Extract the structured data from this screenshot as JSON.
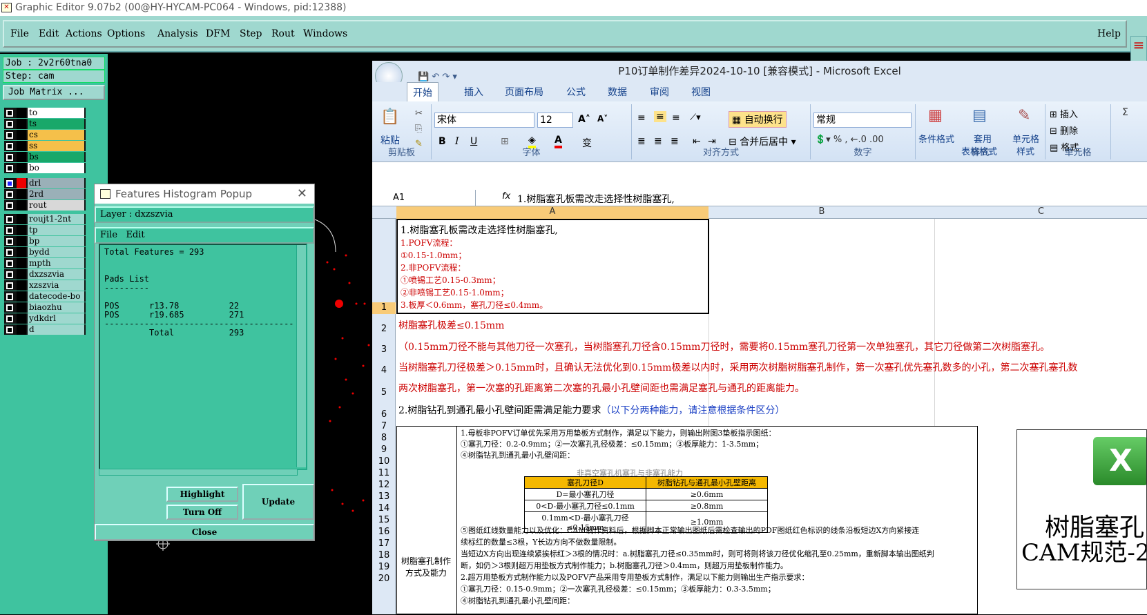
{
  "window": {
    "title": "Graphic Editor 9.07b2 (00@HY-HYCAM-PC064 - Windows, pid:12388)"
  },
  "menu": [
    "File",
    "Edit",
    "Actions",
    "Options",
    "Analysis",
    "DFM",
    "Step",
    "Rout",
    "Windows"
  ],
  "help": "Help",
  "job": {
    "job": "Job : 2v2r60tna0",
    "step": "Step: cam",
    "matrix": "Job Matrix ..."
  },
  "layers1": [
    {
      "name": "to",
      "color": "#ffffff"
    },
    {
      "name": "ts",
      "color": "#19a86a"
    },
    {
      "name": "cs",
      "color": "#f5c04a"
    },
    {
      "name": "ss",
      "color": "#f5c04a"
    },
    {
      "name": "bs",
      "color": "#19a86a"
    },
    {
      "name": "bo",
      "color": "#ffffff"
    }
  ],
  "layers2": [
    {
      "name": "drl",
      "color": "#9ab0b8"
    },
    {
      "name": "2rd",
      "color": "#9ab0b8"
    },
    {
      "name": "rout",
      "color": "#d8d8d8"
    }
  ],
  "layers3": [
    "roujt1-2nt",
    "tp",
    "bp",
    "bydd",
    "mpth",
    "dxzszvia",
    "xzszvia",
    "datecode-bo",
    "biaozhu",
    "ydkdrl",
    "d"
  ],
  "hist": {
    "title": "Features Histogram Popup",
    "layer": "Layer :  dxzszvia",
    "file": "File",
    "edit": "Edit",
    "content": "Total Features = 293\n\n\nPads List\n---------\n\nPOS      r13.78          22\nPOS      r19.685         271\n--------------------------------------\n         Total           293",
    "highlight": "Highlight",
    "turnoff": "Turn Off",
    "update": "Update",
    "close": "Close"
  },
  "excel": {
    "title": "P10订单制作差异2024-10-10  [兼容模式] - Microsoft Excel",
    "tabs": [
      "开始",
      "插入",
      "页面布局",
      "公式",
      "数据",
      "审阅",
      "视图"
    ],
    "font": "宋体",
    "size": "12",
    "paste": "粘贴",
    "wrap": "自动换行",
    "merge": "合并后居中",
    "numfmt": "常规",
    "cond": "条件格式",
    "table1": "套用",
    "table2": "表格格式",
    "cellstyle1": "单元格",
    "cellstyle2": "样式",
    "insert": "插入",
    "delete": "删除",
    "format": "格式",
    "groups": [
      "剪贴板",
      "字体",
      "对齐方式",
      "数字",
      "样式",
      "单元格"
    ],
    "namebox": "A1",
    "formula": "1.树脂塞孔板需改走选择性树脂塞孔,",
    "cols": [
      "A",
      "B",
      "C"
    ],
    "rows": [
      "1",
      "2",
      "3",
      "4",
      "5",
      "6",
      "7",
      "8",
      "9",
      "10",
      "11",
      "12",
      "13",
      "14",
      "15",
      "16",
      "17",
      "18",
      "19",
      "20"
    ],
    "a1": [
      "1.树脂塞孔板需改走选择性树脂塞孔,",
      "1.POFV流程：",
      "①0.15-1.0mm；",
      "2.非POFV流程：",
      "①喷锡工艺0.15-0.3mm；",
      "②非喷锡工艺0.15-1.0mm；",
      "3.板厚＜0.6mm，塞孔刀径≤0.4mm。"
    ],
    "r2": "树脂塞孔极差≤0.15mm",
    "r3": "（0.15mm刀径不能与其他刀径一次塞孔，当树脂塞孔刀径含0.15mm刀径时，需要将0.15mm塞孔刀径第一次单独塞孔，其它刀径做第二次树脂塞孔。",
    "r4": "当树脂塞孔刀径极差＞0.15mm时，且确认无法优化到0.15mm极差以内时，采用两次树脂树脂塞孔制作，第一次塞孔优先塞孔数多的小孔，第二次塞孔塞孔数",
    "r5": "两次树脂塞孔，第一次塞的孔距离第二次塞的孔最小孔壁间距也需满足塞孔与通孔的距离能力。",
    "r6a": "2.树脂钻孔到通孔最小孔壁间距需满足能力要求",
    "r6b": "（以下分两种能力，请注意根据条件区分）",
    "label": [
      "树脂塞孔制作",
      "方式及能力"
    ],
    "doc": [
      "1.母板非POFV订单优先采用万用垫板方式制作，满足以下能力，则输出附图3垫板指示图纸：",
      "①塞孔刀径：0.2-0.9mm；②一次塞孔孔径极差：≤0.15mm；③板厚能力：1-3.5mm；",
      "④树脂钻孔到通孔最小孔壁间距："
    ],
    "tcap": "非真空塞孔机塞孔与非塞孔能力",
    "thead": [
      "塞孔刀径D",
      "树脂钻孔与通孔最小孔壁距离"
    ],
    "trows": [
      [
        "D=最小塞孔刀径",
        "≥0.6mm"
      ],
      [
        "0<D-最小塞孔刀径≤0.1mm",
        "≥0.8mm"
      ],
      [
        "0.1mm<D-最小塞孔刀径≤0.15mm",
        "≥1.0mm"
      ]
    ],
    "doc2": [
      "⑤图纸红线数量能力以及优化：CAM制作资料后，根据脚本正常输出图纸后需检查输出的PDF图纸红色标识的线条沿板短边X方向紧接连",
      "续标红的数量≤3根，Y长边方向不做数量限制。",
      "当短边X方向出现连续紧挨标红＞3根的情况时：a.树脂塞孔刀径≤0.35mm时，则可将则将该刀径优化缩孔至0.25mm，重新脚本输出图纸判",
      "断，如仍＞3根则超万用垫板方式制作能力；b.树脂塞孔刀径＞0.4mm，则超万用垫板制作能力。",
      "2.超万用垫板方式制作能力以及POFV产品采用专用垫板方式制作，满足以下能力则输出生产指示要求：",
      "①塞孔刀径：0.15-0.9mm；②一次塞孔孔径极差：≤0.15mm；③板厚能力：0.3-3.5mm；",
      "④树脂钻孔到通孔最小孔壁间距："
    ],
    "big1": "树脂塞孔",
    "big2": "CAM规范-2"
  }
}
